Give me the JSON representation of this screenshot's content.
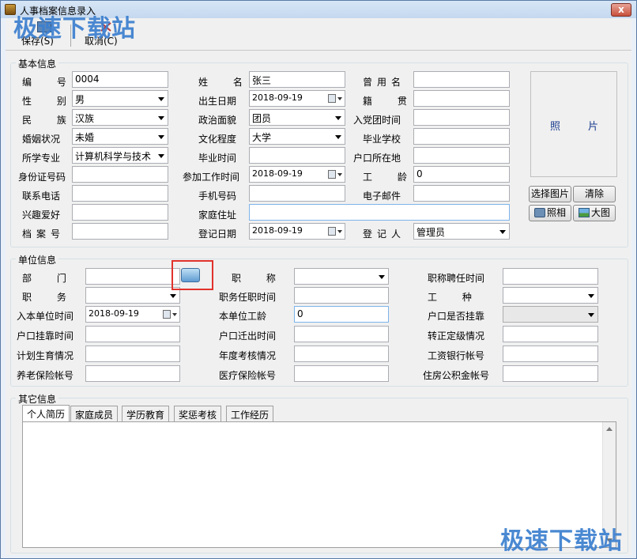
{
  "window": {
    "title": "人事档案信息录入",
    "close_label": "x"
  },
  "watermark": "极速下载站",
  "toolbar": {
    "save_label": "保存(S)",
    "cancel_label": "取消(C)"
  },
  "basic": {
    "title": "基本信息",
    "labels": {
      "id": "编 号",
      "gender": "性 别",
      "ethnicity": "民 族",
      "marital": "婚姻状况",
      "major": "所学专业",
      "idcard": "身份证号码",
      "phone": "联系电话",
      "hobby": "兴趣爱好",
      "archive_no": "档案号",
      "name": "姓 名",
      "birth": "出生日期",
      "political": "政治面貌",
      "education": "文化程度",
      "grad_time": "毕业时间",
      "work_start": "参加工作时间",
      "mobile": "手机号码",
      "address": "家庭住址",
      "reg_date": "登记日期",
      "former_name": "曾用名",
      "native": "籍 贯",
      "party_date": "入党团时间",
      "school": "毕业学校",
      "hukou": "户口所在地",
      "seniority": "工 龄",
      "email": "电子邮件",
      "registrar": "登记人"
    },
    "values": {
      "id": "0004",
      "gender": "男",
      "ethnicity": "汉族",
      "marital": "未婚",
      "major": "计算机科学与技术",
      "name": "张三",
      "birth": "2018-09-19",
      "political": "团员",
      "education": "大学",
      "work_start": "2018-09-19",
      "reg_date": "2018-09-19",
      "seniority": "0",
      "registrar": "管理员"
    },
    "photo": {
      "left": "照",
      "right": "片"
    },
    "buttons": {
      "choose": "选择图片",
      "clear": "清除",
      "camera": "照相",
      "large": "大图"
    }
  },
  "unit": {
    "title": "单位信息",
    "labels": {
      "dept": "部 门",
      "duty": "职 务",
      "join_date": "入本单位时间",
      "hukou_linked": "户口挂靠时间",
      "birth_plan": "计划生育情况",
      "pension": "养老保险帐号",
      "title_rank": "职 称",
      "duty_date": "职务任职时间",
      "unit_years": "本单位工龄",
      "hukou_out": "户口迁出时间",
      "annual_review": "年度考核情况",
      "medical": "医疗保险帐号",
      "title_date": "职称聘任时间",
      "work_type": "工 种",
      "is_linked": "户口是否挂靠",
      "regular": "转正定级情况",
      "bank": "工资银行帐号",
      "housing": "住房公积金帐号"
    },
    "values": {
      "join_date": "2018-09-19",
      "unit_years": "0"
    }
  },
  "other": {
    "title": "其它信息",
    "tabs": [
      "个人简历",
      "家庭成员",
      "学历教育",
      "奖惩考核",
      "工作经历"
    ]
  }
}
